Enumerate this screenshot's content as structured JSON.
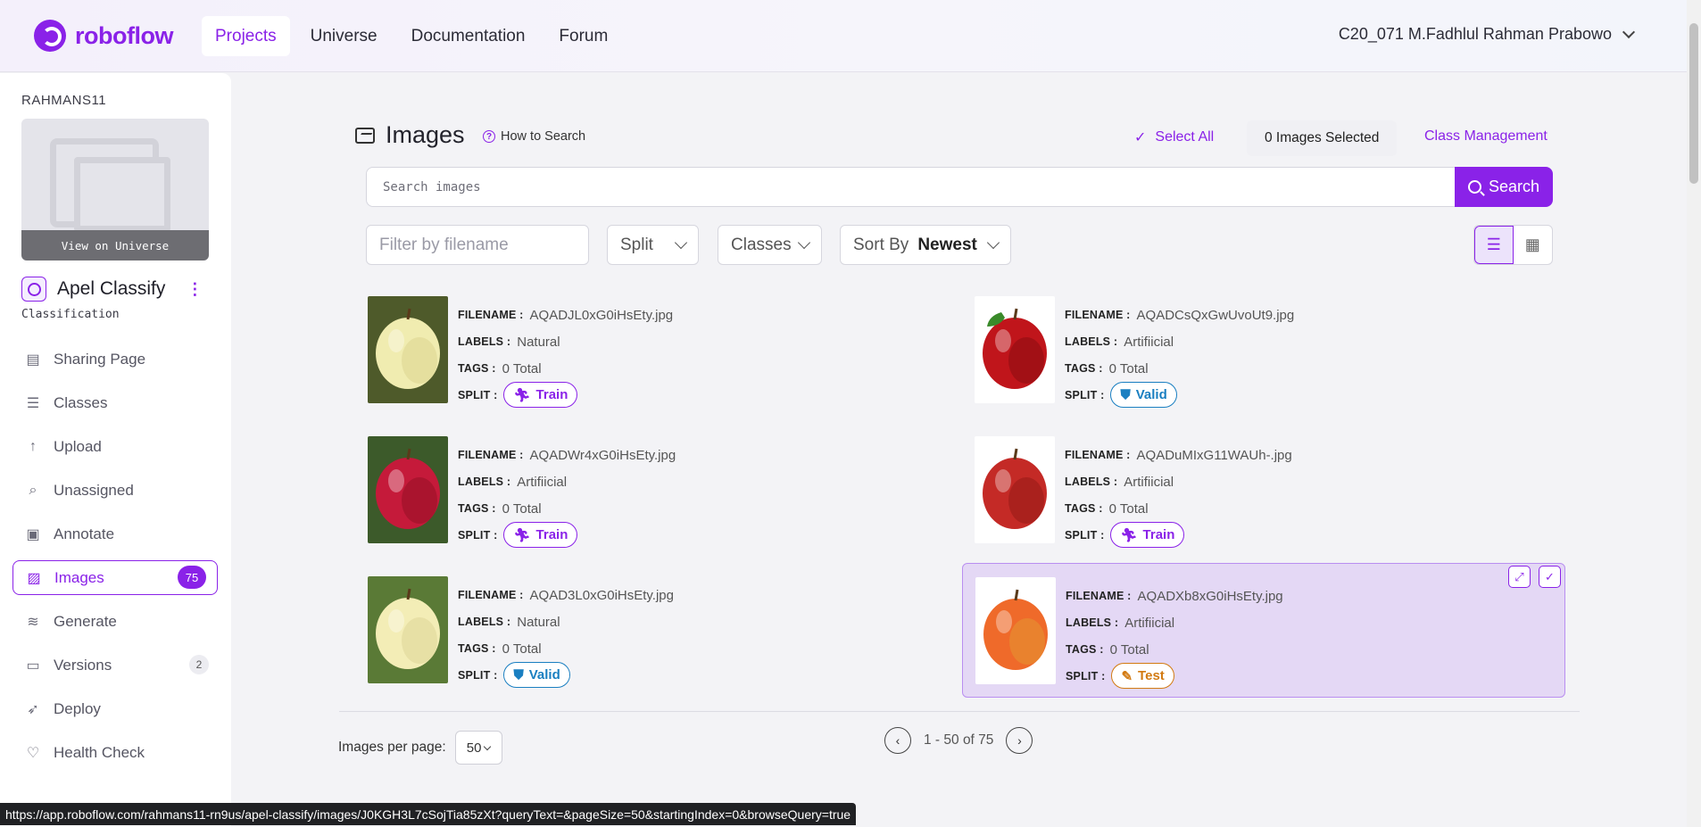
{
  "header": {
    "logo": "roboflow",
    "nav": [
      "Projects",
      "Universe",
      "Documentation",
      "Forum"
    ],
    "active_nav": "Projects",
    "user": "C20_071 M.Fadhlul Rahman Prabowo"
  },
  "sidebar": {
    "workspace": "RAHMANS11",
    "view_universe": "View on Universe",
    "project_name": "Apel Classify",
    "project_type": "Classification",
    "items": [
      {
        "label": "Sharing Page",
        "icon": "document-icon",
        "glyph": "▤"
      },
      {
        "label": "Classes",
        "icon": "list-icon",
        "glyph": "☰"
      },
      {
        "label": "Upload",
        "icon": "upload-arrow-icon",
        "glyph": "↑"
      },
      {
        "label": "Unassigned",
        "icon": "search-icon",
        "glyph": "⌕"
      },
      {
        "label": "Annotate",
        "icon": "annotate-icon",
        "glyph": "▣"
      },
      {
        "label": "Images",
        "icon": "images-icon",
        "glyph": "▨",
        "badge": "75"
      },
      {
        "label": "Generate",
        "icon": "layers-icon",
        "glyph": "≋"
      },
      {
        "label": "Versions",
        "icon": "versions-icon",
        "glyph": "▭",
        "badge": "2"
      },
      {
        "label": "Deploy",
        "icon": "rocket-icon",
        "glyph": "➶"
      },
      {
        "label": "Health Check",
        "icon": "heart-pulse-icon",
        "glyph": "♡"
      }
    ]
  },
  "main": {
    "title": "Images",
    "how_to_search": "How to Search",
    "select_all": "Select All",
    "selected_count": "0 Images Selected",
    "class_management": "Class Management",
    "search_placeholder": "Search images",
    "search_button": "Search",
    "filter_placeholder": "Filter by filename",
    "split_label": "Split",
    "classes_label": "Classes",
    "sort_label": "Sort By",
    "sort_value": "Newest"
  },
  "field_labels": {
    "filename": "FILENAME :",
    "labels": "LABELS :",
    "tags": "TAGS :",
    "split": "SPLIT :"
  },
  "images": [
    {
      "filename": "AQADJL0xG0iHsEty.jpg",
      "label": "Natural",
      "tags": "0 Total",
      "split": "Train",
      "apple": "yellow"
    },
    {
      "filename": "AQADCsQxGwUvoUt9.jpg",
      "label": "Artifiicial",
      "tags": "0 Total",
      "split": "Valid",
      "apple": "red-leaf"
    },
    {
      "filename": "AQADWr4xG0iHsEty.jpg",
      "label": "Artifiicial",
      "tags": "0 Total",
      "split": "Train",
      "apple": "red-tree"
    },
    {
      "filename": "AQADuMIxG11WAUh-.jpg",
      "label": "Artifiicial",
      "tags": "0 Total",
      "split": "Train",
      "apple": "red"
    },
    {
      "filename": "AQAD3L0xG0iHsEty.jpg",
      "label": "Natural",
      "tags": "0 Total",
      "split": "Valid",
      "apple": "yellow-leaf"
    },
    {
      "filename": "AQADXb8xG0iHsEty.jpg",
      "label": "Artifiicial",
      "tags": "0 Total",
      "split": "Test",
      "apple": "gala",
      "selected": true
    }
  ],
  "pagination": {
    "per_page_label": "Images per page:",
    "per_page": "50",
    "range": "1 - 50 of 75"
  },
  "status_url": "https://app.roboflow.com/rahmans11-rn9us/apel-classify/images/J0KGH3L7cSojTia85zXt?queryText=&pageSize=50&startingIndex=0&browseQuery=true",
  "colors": {
    "accent": "#8a22e8",
    "valid": "#1a7fc1",
    "test": "#d27a12"
  }
}
